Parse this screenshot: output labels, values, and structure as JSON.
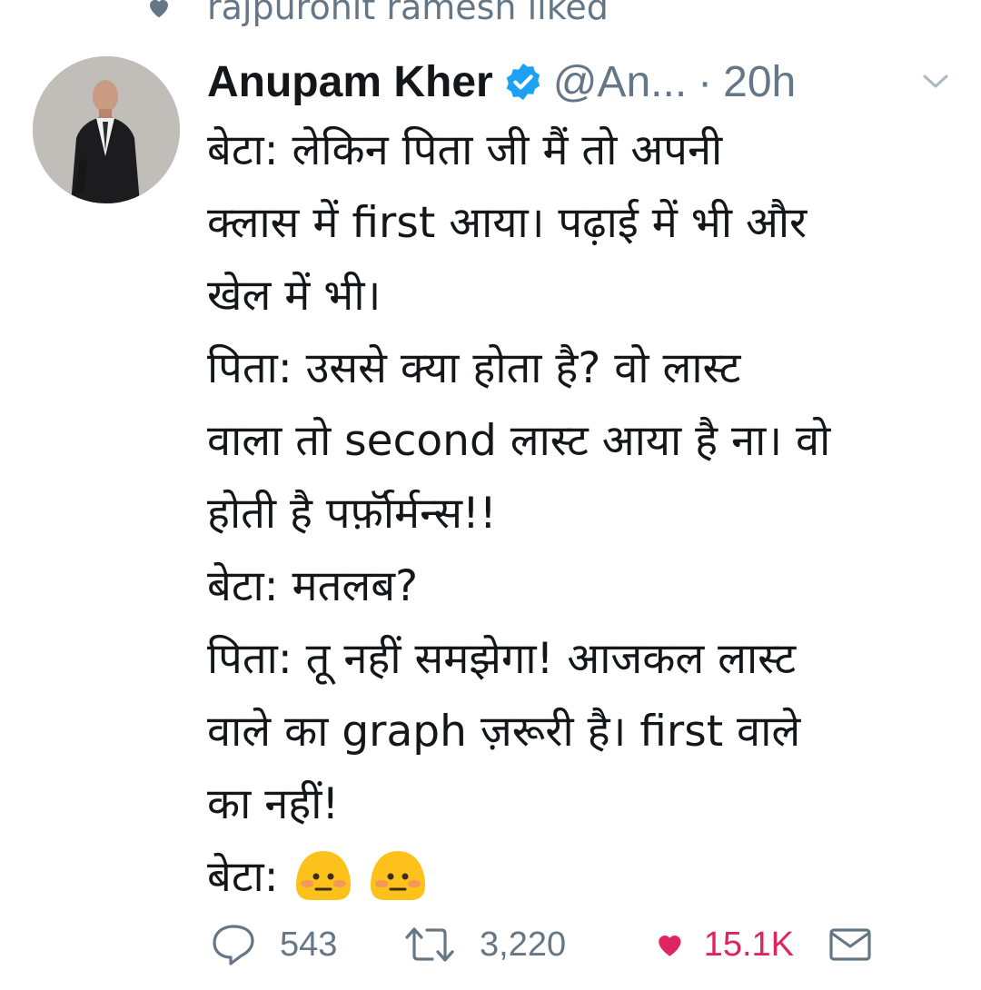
{
  "social_context": {
    "text": "rajpurohit ramesh liked",
    "icon": "heart-icon"
  },
  "author": {
    "name": "Anupam Kher",
    "handle": "@An...",
    "time": "20h",
    "verified": true,
    "verified_color": "#1da1f2"
  },
  "separator": "·",
  "tweet": {
    "lines": [
      "बेटा: लेकिन पिता जी मैं तो अपनी",
      "क्लास में first आया। पढ़ाई में भी और",
      "खेल में भी।",
      "पिता: उससे क्या होता है? वो लास्ट",
      "वाला तो second लास्ट आया है ना। वो",
      "होती है पर्फ़ॉर्मन्स!!",
      "बेटा: मतलब?",
      "पिता: तू नहीं समझेगा! आजकल लास्ट",
      "वाले का graph ज़रूरी है। first वाले",
      "का नहीं!",
      "बेटा:"
    ],
    "emojis": [
      "flushed-face-emoji",
      "flushed-face-emoji"
    ]
  },
  "actions": {
    "reply_count": "543",
    "retweet_count": "3,220",
    "like_count": "15.1K",
    "like_color": "#e0245e",
    "muted_color": "#657786"
  }
}
